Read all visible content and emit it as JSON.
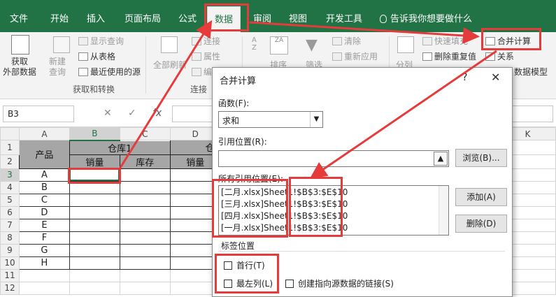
{
  "ribbon_tabs": [
    "文件",
    "开始",
    "插入",
    "页面布局",
    "公式",
    "数据",
    "审阅",
    "视图",
    "开发工具"
  ],
  "active_tab": "数据",
  "tell_me": "告诉我你想要做什么",
  "ribbon": {
    "get_external": "获取\n外部数据",
    "new_query": "新建\n查询",
    "show_queries": "显示查询",
    "from_table": "从表格",
    "recent_sources": "最近使用的源",
    "group_get_transform": "获取和转换",
    "refresh_all": "全部刷新",
    "connections": "连接",
    "properties": "属性",
    "edit_links": "编",
    "group_connections": "连接",
    "sort": "排序",
    "filter": "筛选",
    "clear": "清除",
    "reapply": "重新应用",
    "split": "分列",
    "flash_fill": "快速填充",
    "remove_dup": "删除重复值",
    "consolidate": "合并计算",
    "relationships": "关系",
    "data_model": "数据模型"
  },
  "formula_bar": {
    "name_box": "B3",
    "fx": "fx",
    "cancel": "✕",
    "enter": "✓"
  },
  "sheet": {
    "columns": [
      "A",
      "B",
      "C",
      "D",
      "K"
    ],
    "rows": [
      "1",
      "2",
      "3",
      "4",
      "5",
      "6",
      "7",
      "8",
      "9",
      "10",
      "11",
      "12"
    ],
    "header_product": "产品",
    "header_warehouse1": "仓库1",
    "header_warehouse2_partial": "仓",
    "sub_sales": "销量",
    "sub_stock": "库存",
    "products": [
      "A",
      "B",
      "C",
      "D",
      "E",
      "F",
      "G",
      "H"
    ]
  },
  "dialog": {
    "title": "合并计算",
    "help": "?",
    "close": "✕",
    "function_label": "函数(F):",
    "function_value": "求和",
    "reference_label": "引用位置(R):",
    "browse": "浏览(B)...",
    "all_refs_label": "所有引用位置(E):",
    "refs": [
      "[二月.xlsx]Sheet1!$B$3:$E$10",
      "[三月.xlsx]Sheet1!$B$3:$E$10",
      "[四月.xlsx]Sheet1!$B$3:$E$10",
      "[一月.xlsx]Sheet1!$B$3:$E$10"
    ],
    "add": "添加(A)",
    "delete": "删除(D)",
    "label_position": "标签位置",
    "top_row": "首行(T)",
    "left_column": "最左列(L)",
    "create_links": "创建指向源数据的链接(S)"
  },
  "colors": {
    "excel_green": "#217346",
    "annotation_red": "#e53b3b",
    "header_grey": "#a6a6a6"
  }
}
